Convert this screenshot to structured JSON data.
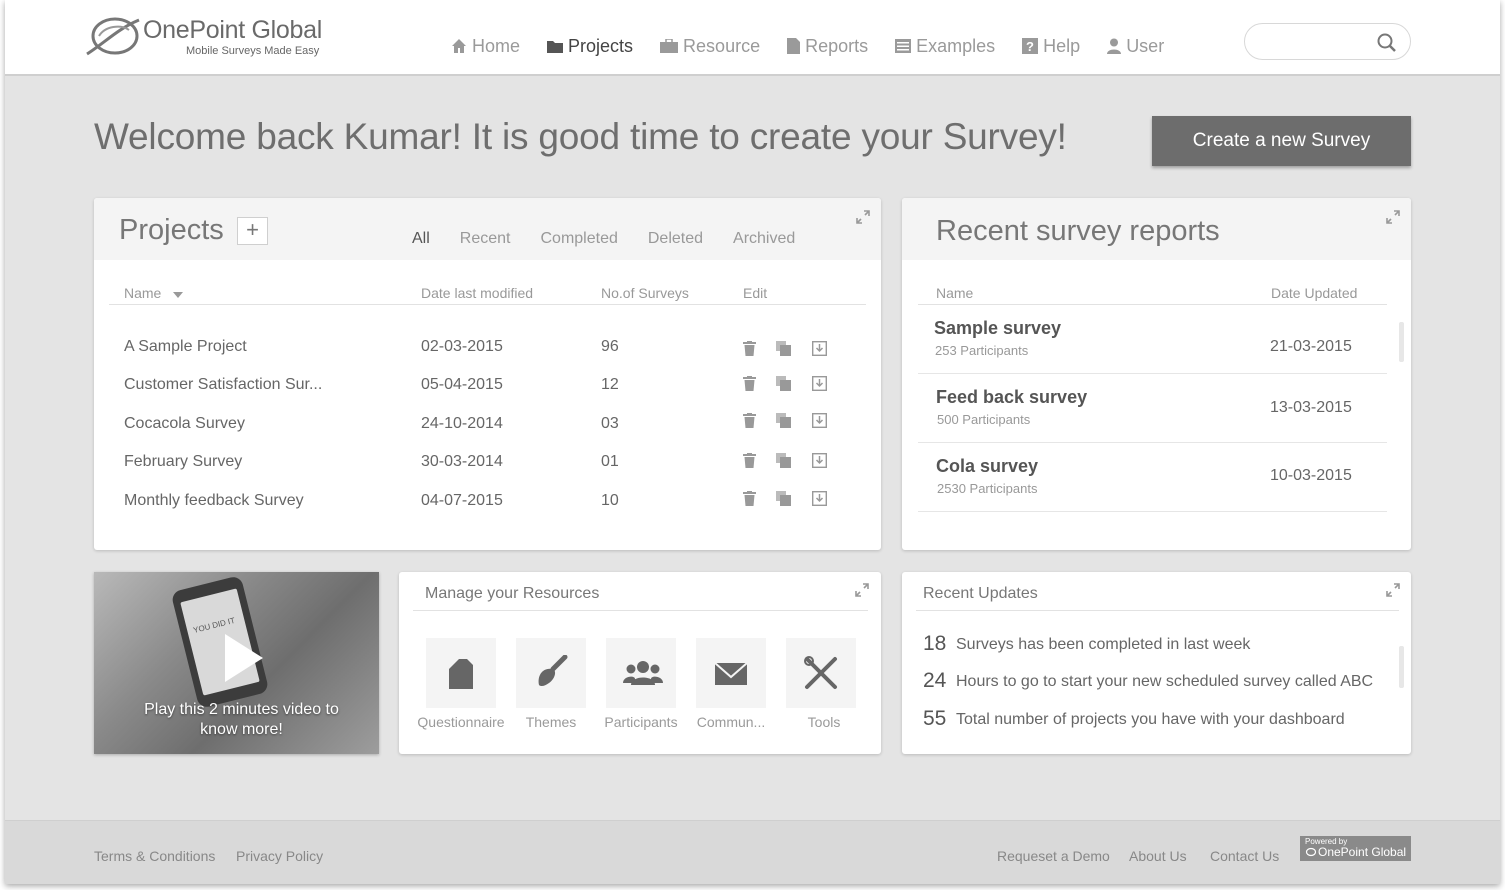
{
  "brand": {
    "name": "OnePoint Global",
    "tagline": "Mobile Surveys Made Easy"
  },
  "nav": {
    "home": "Home",
    "projects": "Projects",
    "resource": "Resource",
    "reports": "Reports",
    "examples": "Examples",
    "help": "Help",
    "user": "User"
  },
  "search": {
    "placeholder": ""
  },
  "welcome": {
    "message": "Welcome back Kumar! It is good time to create  your Survey!",
    "create_button": "Create a new Survey"
  },
  "projects": {
    "title": "Projects",
    "add_label": "+",
    "filters": [
      "All",
      "Recent",
      "Completed",
      "Deleted",
      "Archived"
    ],
    "columns": {
      "name": "Name",
      "modified": "Date last modified",
      "surveys": "No.of Surveys",
      "edit": "Edit"
    },
    "rows": [
      {
        "name": "A Sample Project",
        "date": "02-03-2015",
        "count": "96"
      },
      {
        "name": "Customer Satisfaction Sur...",
        "date": "05-04-2015",
        "count": "12"
      },
      {
        "name": "Cocacola Survey",
        "date": "24-10-2014",
        "count": "03"
      },
      {
        "name": "February Survey",
        "date": "30-03-2014",
        "count": "01"
      },
      {
        "name": "Monthly feedback Survey",
        "date": "04-07-2015",
        "count": "10"
      }
    ]
  },
  "reports": {
    "title": "Recent survey reports",
    "columns": {
      "name": "Name",
      "date": "Date Updated"
    },
    "rows": [
      {
        "name": "Sample survey",
        "participants": "253 Participants",
        "date": "21-03-2015"
      },
      {
        "name": "Feed back survey",
        "participants": "500 Participants",
        "date": "13-03-2015"
      },
      {
        "name": "Cola survey",
        "participants": "2530 Participants",
        "date": "10-03-2015"
      }
    ]
  },
  "video": {
    "caption_line1": "Play this 2 minutes video to",
    "caption_line2": "know more!",
    "screen_text": "YOU DID IT"
  },
  "resources": {
    "title": "Manage  your Resources",
    "items": [
      "Questionnaire",
      "Themes",
      "Participants",
      "Commun...",
      "Tools"
    ]
  },
  "updates": {
    "title": "Recent Updates",
    "items": [
      {
        "num": "18",
        "text": "Surveys has been completed in last week"
      },
      {
        "num": "24",
        "text": "Hours to go to start your new scheduled survey called ABC"
      },
      {
        "num": "55",
        "text": "Total number of projects you have with your dashboard"
      }
    ]
  },
  "footer": {
    "terms": "Terms & Conditions",
    "privacy": "Privacy Policy",
    "demo": "Requeset a Demo",
    "about": "About Us",
    "contact": "Contact Us",
    "powered_by": "Powered by",
    "powered_name": "OnePoint Global"
  },
  "colors": {
    "background": "#e4e4e4",
    "card": "#ffffff",
    "card_header": "#f4f4f4",
    "primary_button": "#6d6d6d"
  }
}
